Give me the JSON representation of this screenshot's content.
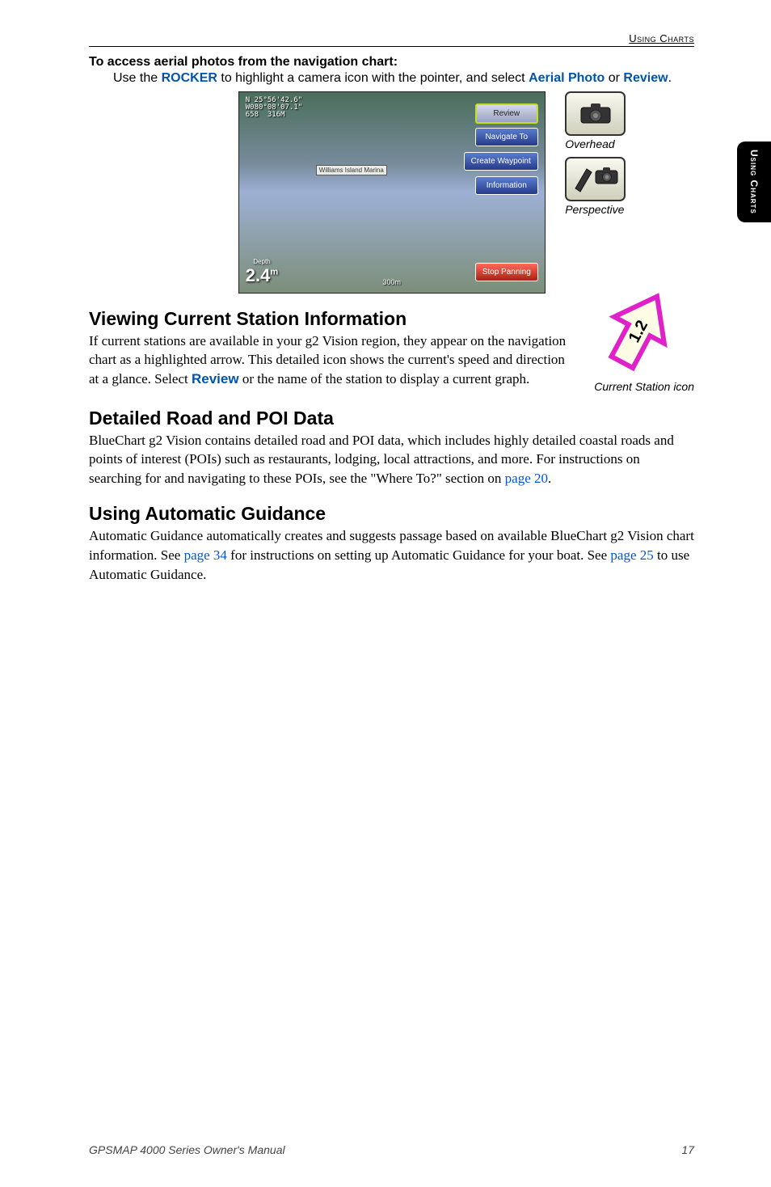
{
  "header": {
    "section": "Using Charts"
  },
  "sideTab": {
    "text": "Using Charts"
  },
  "instruction": {
    "heading": "To access aerial photos from the navigation chart:",
    "body_pre": "Use the ",
    "rocker": "ROCKER",
    "body_mid": " to highlight a camera icon with the pointer, and select ",
    "aerial": "Aerial Photo",
    "body_or": " or ",
    "review": "Review",
    "body_end": "."
  },
  "chartScreenshot": {
    "coords_lat": "N  25°56'42.6\"",
    "coords_lon": "W080°08'07.1\"",
    "coords_dist": "658",
    "coords_brg": "316M",
    "depth_label": "Depth",
    "depth_value": "2.4",
    "depth_unit": "m",
    "scale": "300m",
    "island_label": "Williams Island Marina",
    "buttons": {
      "review": "Review",
      "navigate": "Navigate To",
      "waypoint": "Create Waypoint",
      "information": "Information",
      "stop": "Stop Panning"
    }
  },
  "icons": {
    "overhead": "Overhead",
    "perspective": "Perspective"
  },
  "sections": {
    "currentStation": {
      "title": "Viewing Current Station Information",
      "body_pre": "If current stations are available in your g2 Vision region, they appear on the navigation chart as a highlighted arrow. This detailed icon shows the current's speed and direction at a glance. Select ",
      "review": "Review",
      "body_post": " or the name of the station to display a current graph.",
      "iconCaption": "Current Station icon",
      "iconValue": "1.2"
    },
    "roadPoi": {
      "title": "Detailed Road and POI Data",
      "body_pre": "BlueChart g2 Vision contains detailed road and POI data, which includes highly detailed coastal roads and points of interest (POIs) such as restaurants, lodging, local attractions, and more. For instructions on searching for and navigating to these POIs, see the \"Where To?\" section on ",
      "link": "page 20",
      "body_end": "."
    },
    "autoGuidance": {
      "title": "Using Automatic Guidance",
      "body_pre": "Automatic Guidance automatically creates and suggests passage based on available BlueChart g2 Vision chart information. See ",
      "link1": "page 34",
      "body_mid": " for instructions on setting up Automatic Guidance for your boat. See ",
      "link2": "page 25",
      "body_end": " to use Automatic Guidance."
    }
  },
  "footer": {
    "manual": "GPSMAP 4000 Series Owner's Manual",
    "page": "17"
  }
}
